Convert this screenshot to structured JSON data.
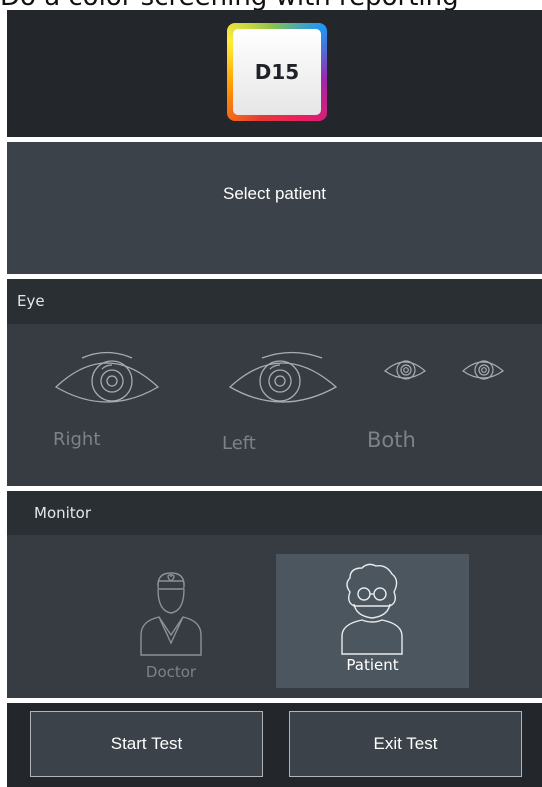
{
  "caption": "Do a color screening with reporting",
  "logo": {
    "text": "D15"
  },
  "patient": {
    "select_label": "Select patient"
  },
  "eye": {
    "title": "Eye",
    "options": [
      {
        "label": "Right"
      },
      {
        "label": "Left"
      },
      {
        "label": "Both"
      }
    ]
  },
  "monitor": {
    "title": "Monitor",
    "options": [
      {
        "label": "Doctor",
        "selected": false
      },
      {
        "label": "Patient",
        "selected": true
      }
    ]
  },
  "footer": {
    "start_label": "Start Test",
    "exit_label": "Exit Test"
  },
  "colors": {
    "header_bg": "#23272b",
    "panel_bg": "#363c42",
    "selected_bg": "#4c565f"
  }
}
